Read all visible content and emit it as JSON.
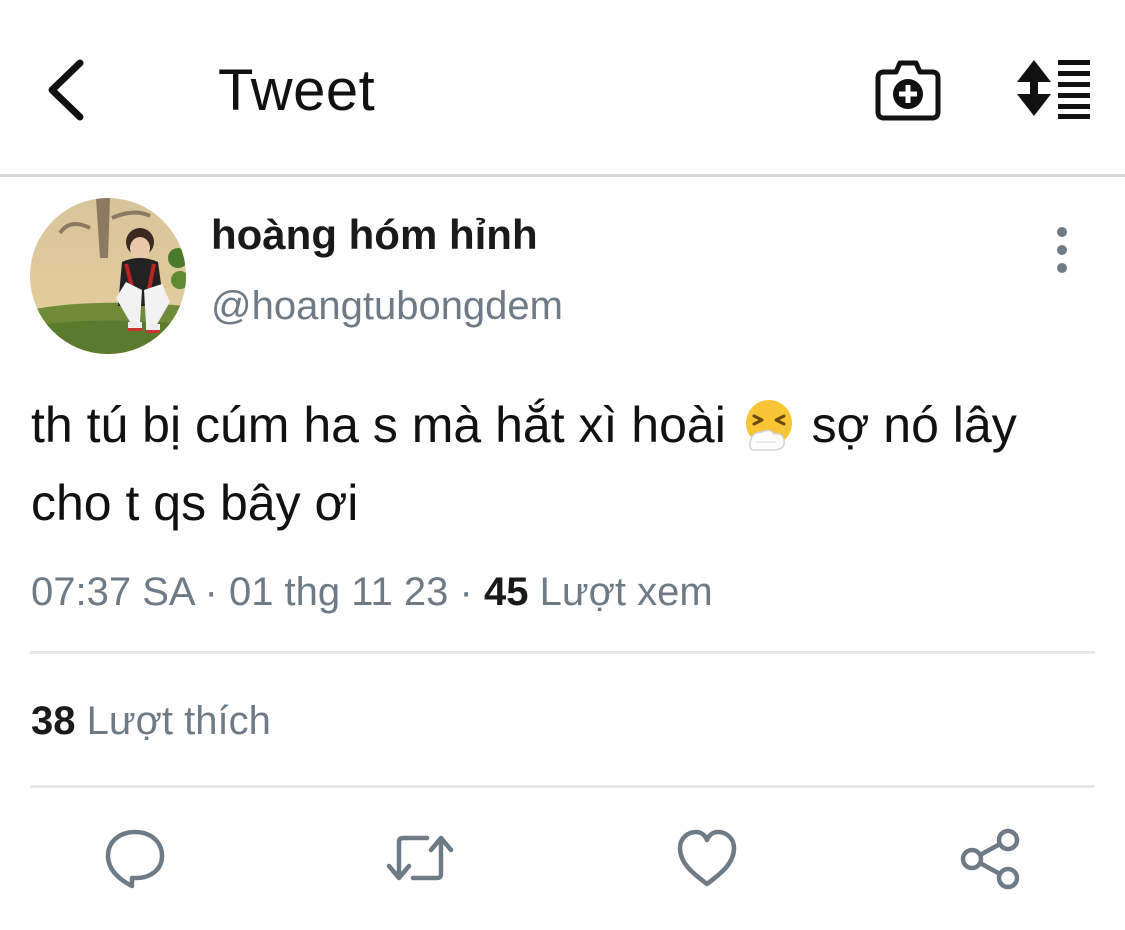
{
  "header": {
    "title": "Tweet",
    "back_icon": "chevron-left-icon",
    "camera_icon": "camera-add-icon",
    "sort_icon": "sort-list-icon"
  },
  "tweet": {
    "author": {
      "display_name": "hoàng hóm hỉnh",
      "handle": "@hoangtubongdem"
    },
    "text_before_emoji": "th tú bị cúm ha s mà hắt xì hoài ",
    "emoji": "sneezing-face-emoji",
    "text_after_emoji": " sợ nó lây cho t qs bây ơi",
    "time": "07:37 SA",
    "separator": "·",
    "date": "01 thg 11 23",
    "views_count": "45",
    "views_label": "Lượt xem",
    "likes_count": "38",
    "likes_label": "Lượt thích"
  },
  "actions": {
    "reply_icon": "reply-icon",
    "retweet_icon": "retweet-icon",
    "like_icon": "heart-icon",
    "share_icon": "share-icon"
  },
  "colors": {
    "text_primary": "#111111",
    "text_secondary": "#6e7a86",
    "divider": "#e6e9ec",
    "icon": "#6e7a86"
  }
}
